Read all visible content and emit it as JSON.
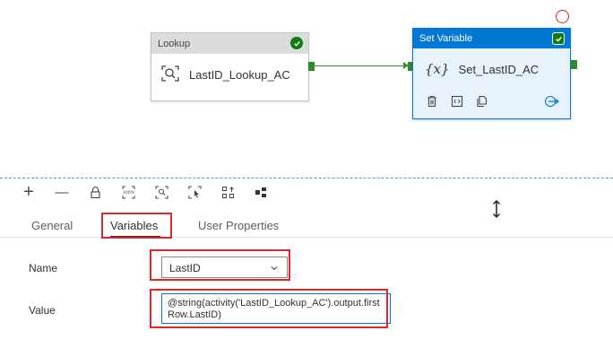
{
  "canvas": {
    "lookup_activity": {
      "header": "Lookup",
      "name": "LastID_Lookup_AC",
      "status": "success"
    },
    "set_variable_activity": {
      "header": "Set Variable",
      "name": "Set_LastID_AC",
      "status": "success",
      "icon_text": "{x}"
    }
  },
  "toolbar": {
    "icons": [
      "add-icon",
      "minus-icon",
      "lock-icon",
      "zoom-100-icon",
      "zoom-fit-icon",
      "select-icon",
      "auto-align-icon",
      "layout-icon"
    ],
    "add": "+",
    "minus": "—"
  },
  "tabs": [
    {
      "label": "General"
    },
    {
      "label": "Variables"
    },
    {
      "label": "User Properties"
    }
  ],
  "active_tab": "Variables",
  "form": {
    "name_label": "Name",
    "name_value": "LastID",
    "value_label": "Value",
    "value_text": "@string(activity('LastID_Lookup_AC').output.firstRow.LastID)"
  },
  "colors": {
    "accent": "#0078d4",
    "success": "#107c10",
    "connector": "#3f8f3f",
    "highlight": "#e3262c"
  }
}
